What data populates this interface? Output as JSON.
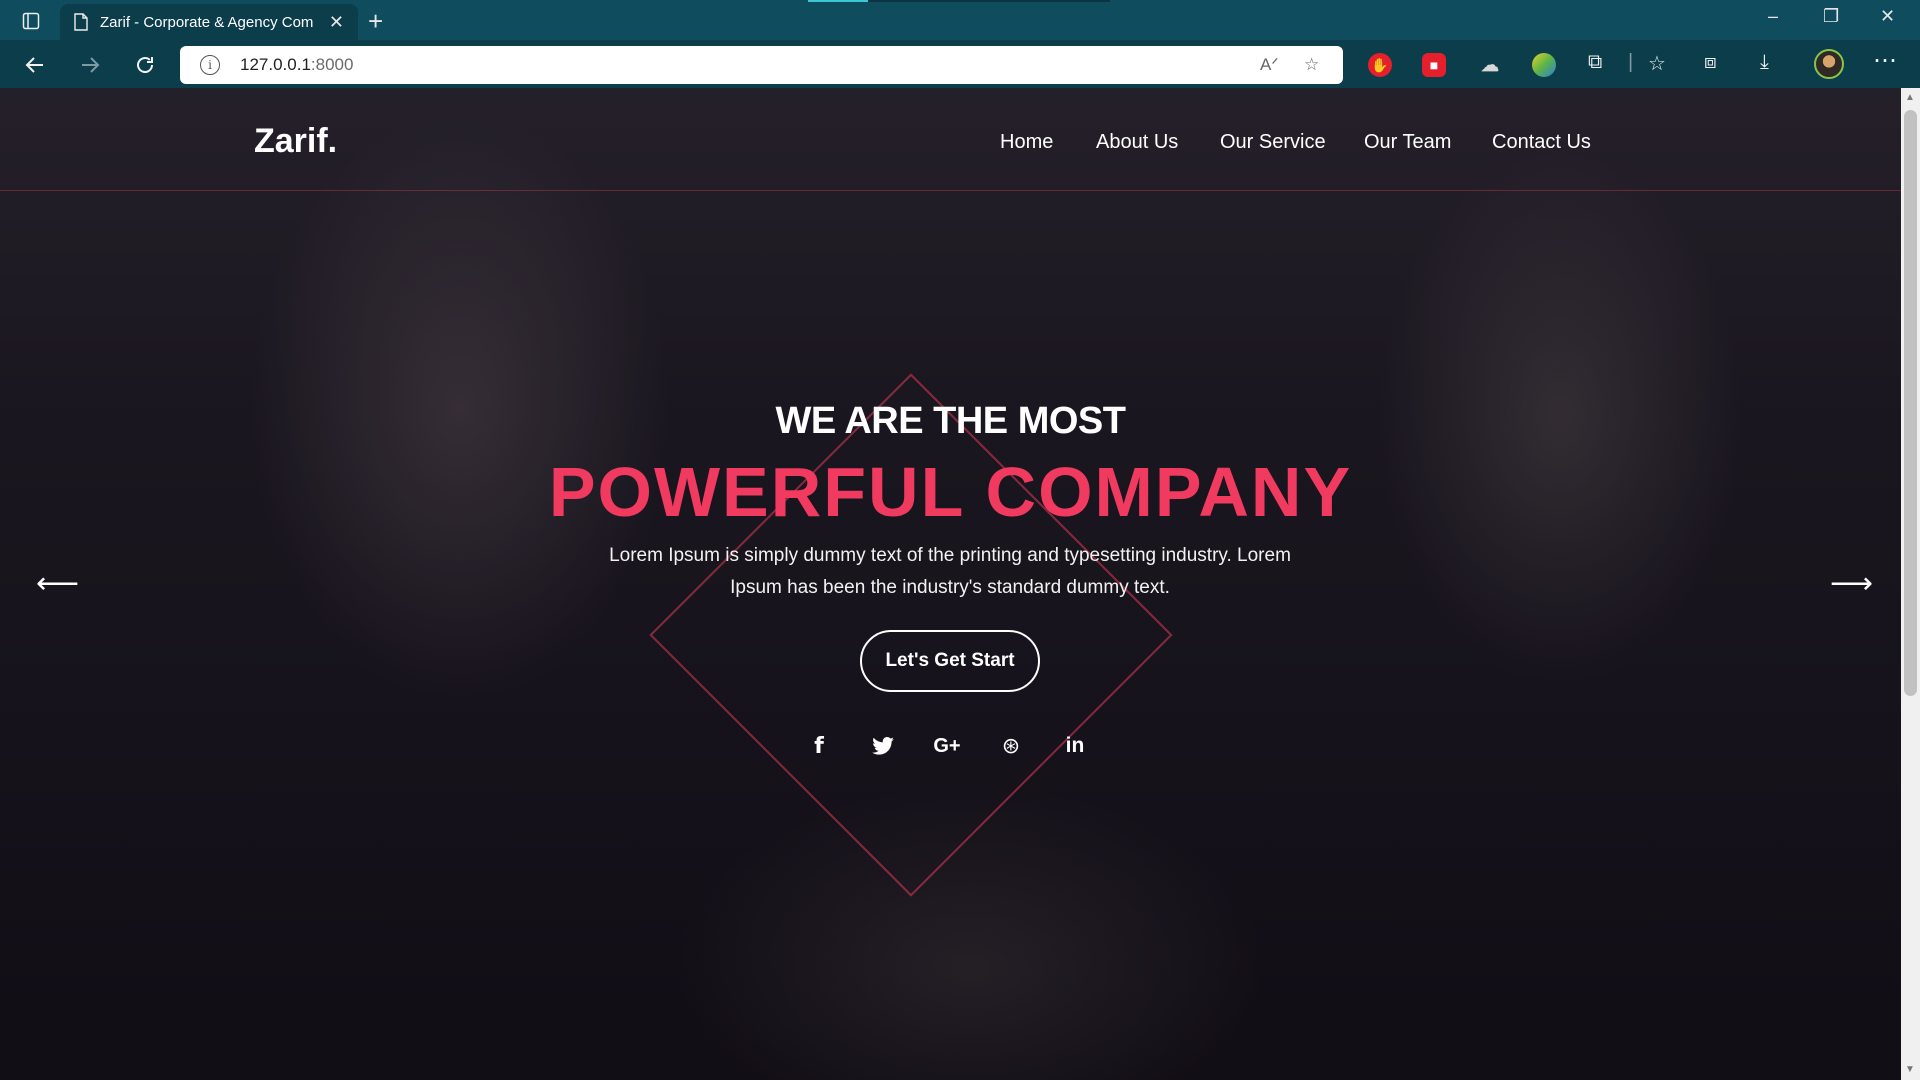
{
  "browser": {
    "tab_title": "Zarif - Corporate & Agency Com",
    "tab_close": "✕",
    "new_tab": "+",
    "url_host": "127.0.0.1",
    "url_port": ":8000",
    "read_aloud": "A",
    "window_controls": [
      "–",
      "❐",
      "✕"
    ],
    "extensions": [
      {
        "name": "adblock-icon",
        "color": "#e51f2b"
      },
      {
        "name": "red-square-icon",
        "color": "#e51f2b"
      },
      {
        "name": "cloud-link-icon",
        "color": "#d8d8d8"
      },
      {
        "name": "rainbow-icon",
        "color": "#5db446"
      },
      {
        "name": "puzzle-icon",
        "color": "#f0f0f0"
      }
    ]
  },
  "site": {
    "logo": "Zarif.",
    "nav": [
      "Home",
      "About Us",
      "Our Service",
      "Our Team",
      "Contact Us"
    ]
  },
  "hero": {
    "subtitle": "WE ARE THE MOST",
    "title": "POWERFUL COMPANY",
    "text": "Lorem Ipsum is simply dummy text of the printing and typesetting industry. Lorem Ipsum has been the industry's standard dummy text.",
    "cta": "Let's Get Start",
    "social": [
      {
        "name": "facebook-icon",
        "glyph": "f"
      },
      {
        "name": "twitter-icon",
        "glyph": "🐦"
      },
      {
        "name": "google-plus-icon",
        "glyph": "G+"
      },
      {
        "name": "dribbble-icon",
        "glyph": "⊛"
      },
      {
        "name": "linkedin-icon",
        "glyph": "in"
      }
    ],
    "prev_arrow": "⟵",
    "next_arrow": "⟶"
  },
  "colors": {
    "accent": "#f03a5f",
    "chrome_dark": "#0b3d4b",
    "chrome_tabbar": "#0f4d5e"
  }
}
